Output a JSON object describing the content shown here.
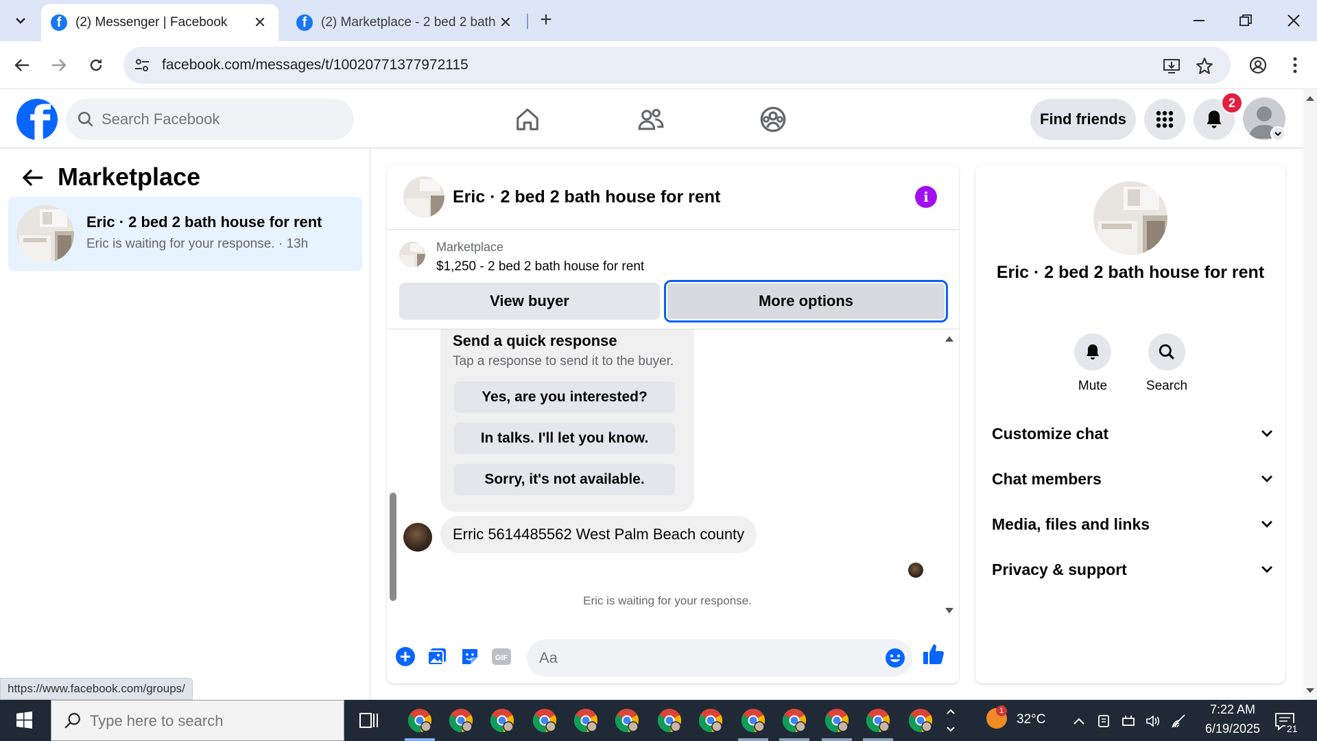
{
  "browser": {
    "tabs": [
      {
        "title": "(2) Messenger | Facebook",
        "active": true
      },
      {
        "title": "(2) Marketplace - 2 bed 2 bath h",
        "active": false
      }
    ],
    "url": "facebook.com/messages/t/10020771377972115",
    "status_url": "https://www.facebook.com/groups/"
  },
  "fb": {
    "search_placeholder": "Search Facebook",
    "find_friends": "Find friends",
    "notification_count": "2"
  },
  "left": {
    "title": "Marketplace",
    "conversation": {
      "name": "Eric · 2 bed 2 bath house for rent",
      "subtitle": "Eric is waiting for your response. · 13h"
    }
  },
  "chat": {
    "title": "Eric · 2 bed 2 bath house for rent",
    "marketplace_label": "Marketplace",
    "listing": "$1,250 - 2 bed 2 bath house for rent",
    "view_buyer": "View buyer",
    "more_options": "More options",
    "quick_title": "Send a quick response",
    "quick_sub": "Tap a response to send it to the buyer.",
    "quick_responses": [
      "Yes, are you interested?",
      "In talks. I'll let you know.",
      "Sorry, it's not available."
    ],
    "message": "Erric 5614485562 West Palm Beach county",
    "waiting": "Eric is waiting for your response.",
    "composer_placeholder": "Aa"
  },
  "right": {
    "name": "Eric · 2 bed 2 bath house for rent",
    "actions": [
      "Mute",
      "Search"
    ],
    "sections": [
      "Customize chat",
      "Chat members",
      "Media, files and links",
      "Privacy & support"
    ]
  },
  "taskbar": {
    "search_placeholder": "Type here to search",
    "temperature": "32°C",
    "weather_badge": "1",
    "time": "7:22 AM",
    "date": "6/19/2025",
    "notifications": "21"
  },
  "colors": {
    "fb_blue": "#0866ff",
    "highlight": "#e7f3ff",
    "focus_border": "#0861f2",
    "info_purple": "#a20ff0",
    "badge_red": "#e41e3f"
  }
}
